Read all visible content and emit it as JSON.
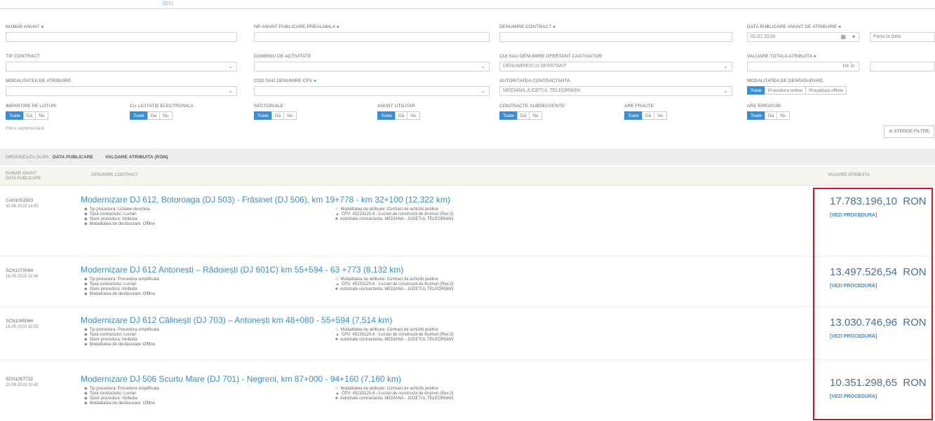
{
  "top_tab": "(ID1)",
  "filters": {
    "numar_anunt": {
      "label": "NUMAR ANUNT"
    },
    "nr_anunt_publicare": {
      "label": "NR ANUNT PUBLICARE PREALABILA"
    },
    "denumire_contract": {
      "label": "DENUMIRE CONTRACT"
    },
    "data_publicare": {
      "label": "DATA PUBLICARE ANUNT DE ATRIBUIRE",
      "value": "01.01.2018",
      "placeholder_to": "Pana la data"
    },
    "tip_contract": {
      "label": "TIP CONTRACT"
    },
    "domeniu_activitate": {
      "label": "DOMENIU DE ACTIVITATE"
    },
    "cui_autoritate": {
      "label": "CUI SAU DENUMIRE OFERTANT CASTIGATOR",
      "value": "DENUMIRE/CUI OFERTANT"
    },
    "valoare_totala": {
      "label": "VALOARE TOTALA ATRIBUITA",
      "value": "De la"
    },
    "modalitatea": {
      "label": "MODALITATEA DE ATRIBUIRE"
    },
    "cod_cpv": {
      "label": "COD SAU DENUMIRE CPV"
    },
    "autoritatea": {
      "label": "AUTORITATEA CONTRACTANTA",
      "value": "MEDIANA JUDETUL TELEORMAN"
    },
    "modalitatea_desfasurare": {
      "label": "MODALITATEA DE DESFASURARE",
      "options": [
        "Toate",
        "Procedura online",
        "Procedura offline"
      ]
    }
  },
  "toggles": [
    {
      "label": "IMPARTIRE PE LOTURI",
      "options": [
        "Toate",
        "Da",
        "Nu"
      ]
    },
    {
      "label": "CU LICITATIE ELECTRONICA",
      "options": [
        "Toate",
        "Da",
        "Nu"
      ]
    },
    {
      "label": "SECTORIALE",
      "options": [
        "Toate",
        "Da",
        "Nu"
      ]
    },
    {
      "label": "ANUNT UTILITAR",
      "options": [
        "Toate",
        "Da",
        "Nu"
      ]
    },
    {
      "label": "CONTRACTE SUBSECVENTE",
      "options": [
        "Toate",
        "Da",
        "Nu"
      ]
    },
    {
      "label": "ARE FRAUTE",
      "options": [
        "Toate",
        "Da",
        "Nu"
      ]
    },
    {
      "label": "ARE ERRATUM",
      "options": [
        "Toate",
        "Da",
        "Nu"
      ]
    }
  ],
  "hide_filters": "Filtre suplimentare",
  "clear_filters": "STERGE FILTRE",
  "sort_bar": {
    "label": "ORDONEAZA DUPA:",
    "options": [
      "DATA PUBLICARE",
      "VALOARE ATRIBUITA (RON)"
    ]
  },
  "table_header": {
    "col1": "NUMAR ANUNT DATA PUBLICARE",
    "col2": "DENUMIRE CONTRACT",
    "col3": "VALOARE ATRIBUITA"
  },
  "rows": [
    {
      "id": "CAN1051503",
      "date": "30.08.2019 14:05",
      "title": "Modernizare DJ 612, Botoroaga (DJ 503) - Frăsinet (DJ 506), km 19+778 - km 32+100 (12,322 km)",
      "left": [
        "Tip procedura: Licitatie deschisa",
        "Tipul contractului: Lucrari",
        "Stare procedura: Atribuita",
        "Modalitatea de desfasurare: Offline"
      ],
      "right": [
        "Modalitatea de atribuire: Contract de achizitii publice",
        "CPV: 45233120-6 - Lucrari de constructii de drumuri (Rev.2)",
        "Autoritate contractanta: MEDIANA - JUDETUL TELEORMAN"
      ],
      "amount": "17.783.196,10",
      "currency": "RON",
      "link": "[VEZI PROCEDURA]"
    },
    {
      "id": "SCN1070068",
      "date": "16.09.2019 11:08",
      "title": "Modernizare DJ 612 Antonesti – Rădoiești (DJ 601C) km 55+594 - 63 +773 (8,132 km)",
      "left": [
        "Tip procedura: Procedura simplificata",
        "Tipul contractului: Lucrari",
        "Stare procedura: Atribuita",
        "Modalitatea de desfasurare: Offline"
      ],
      "right": [
        "Modalitatea de atribuire: Contract de achizitii publice",
        "CPV: 45233120-6 - Lucrari de constructii de drumuri (Rev.2)",
        "Autoritate contractanta: MEDIANA - JUDETUL TELEORMAN"
      ],
      "amount": "13.497.526,54",
      "currency": "RON",
      "link": "[VEZI PROCEDURA]"
    },
    {
      "id": "SCN1065066",
      "date": "16.09.2019 10:55",
      "title": "Modernizare DJ 612 Călinești (DJ 703) – Antonești km 48+080 - 55+594 (7,514 km)",
      "left": [
        "Tip procedura: Procedura simplificata",
        "Tipul contractului: Lucrari",
        "Stare procedura: Atribuita",
        "Modalitatea de desfasurare: Offline"
      ],
      "right": [
        "Modalitatea de atribuire: Contract de achizitii publice",
        "CPV: 45233120-6 - Lucrari de constructii de drumuri (Rev.2)",
        "Autoritate contractanta: MEDIANA - JUDETUL TELEORMAN"
      ],
      "amount": "13.030.746,96",
      "currency": "RON",
      "link": "[VEZI PROCEDURA]"
    },
    {
      "id": "SCN1057722",
      "date": "20.08.2019 10:42",
      "title": "Modernizare DJ 506 Scurtu Mare (DJ 701) - Negreni, km 87+000 - 94+160 (7,160 km)",
      "left": [
        "Tip procedura: Procedura simplificata",
        "Tipul contractului: Lucrari",
        "Stare procedura: Atribuita",
        "Modalitatea de desfasurare: Offline"
      ],
      "right": [
        "Modalitatea de atribuire: Contract de achizitii publice",
        "CPV: 45233120-6 - Lucrari de constructii de drumuri (Rev.2)",
        "Autoritate contractanta: MEDIANA - JUDETUL TELEORMAN"
      ],
      "amount": "10.351.298,65",
      "currency": "RON",
      "link": "[VEZI PROCEDURA]"
    }
  ]
}
